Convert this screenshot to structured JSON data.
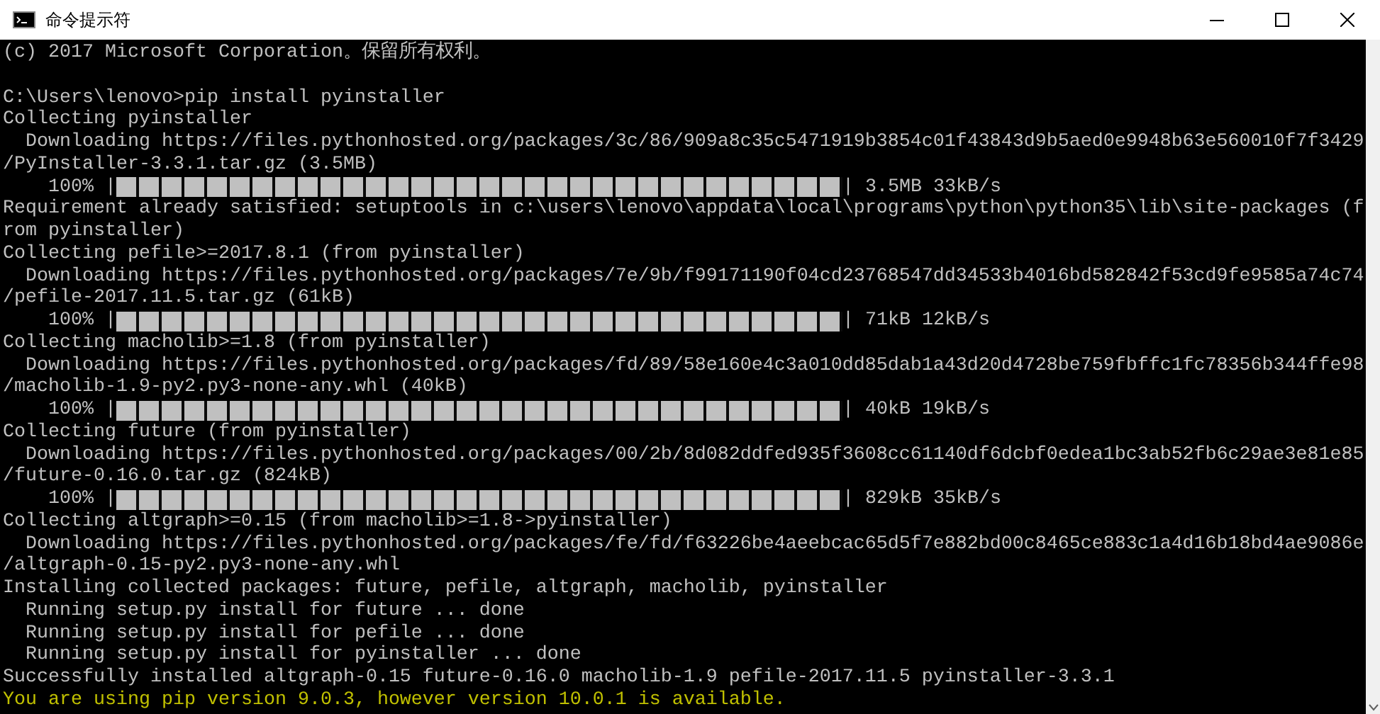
{
  "window": {
    "title": "命令提示符"
  },
  "lines": [
    {
      "kind": "text",
      "text": "(c) 2017 Microsoft Corporation。保留所有权利。"
    },
    {
      "kind": "blank"
    },
    {
      "kind": "text",
      "text": "C:\\Users\\lenovo>pip install pyinstaller"
    },
    {
      "kind": "text",
      "text": "Collecting pyinstaller"
    },
    {
      "kind": "text",
      "text": "  Downloading https://files.pythonhosted.org/packages/3c/86/909a8c35c5471919b3854c01f43843d9b5aed0e9948b63e560010f7f3429"
    },
    {
      "kind": "text",
      "text": "/PyInstaller-3.3.1.tar.gz (3.5MB)"
    },
    {
      "kind": "progress",
      "prefix": "    100% |",
      "level": 1,
      "suffix": "| 3.5MB 33kB/s"
    },
    {
      "kind": "text",
      "text": "Requirement already satisfied: setuptools in c:\\users\\lenovo\\appdata\\local\\programs\\python\\python35\\lib\\site-packages (f"
    },
    {
      "kind": "text",
      "text": "rom pyinstaller)"
    },
    {
      "kind": "text",
      "text": "Collecting pefile>=2017.8.1 (from pyinstaller)"
    },
    {
      "kind": "text",
      "text": "  Downloading https://files.pythonhosted.org/packages/7e/9b/f99171190f04cd23768547dd34533b4016bd582842f53cd9fe9585a74c74"
    },
    {
      "kind": "text",
      "text": "/pefile-2017.11.5.tar.gz (61kB)"
    },
    {
      "kind": "progress",
      "prefix": "    100% |",
      "level": 1,
      "suffix": "| 71kB 12kB/s"
    },
    {
      "kind": "text",
      "text": "Collecting macholib>=1.8 (from pyinstaller)"
    },
    {
      "kind": "text",
      "text": "  Downloading https://files.pythonhosted.org/packages/fd/89/58e160e4c3a010dd85dab1a43d20d4728be759fbffc1fc78356b344ffe98"
    },
    {
      "kind": "text",
      "text": "/macholib-1.9-py2.py3-none-any.whl (40kB)"
    },
    {
      "kind": "progress",
      "prefix": "    100% |",
      "level": 1,
      "suffix": "| 40kB 19kB/s"
    },
    {
      "kind": "text",
      "text": "Collecting future (from pyinstaller)"
    },
    {
      "kind": "text",
      "text": "  Downloading https://files.pythonhosted.org/packages/00/2b/8d082ddfed935f3608cc61140df6dcbf0edea1bc3ab52fb6c29ae3e81e85"
    },
    {
      "kind": "text",
      "text": "/future-0.16.0.tar.gz (824kB)"
    },
    {
      "kind": "progress",
      "prefix": "    100% |",
      "level": 1,
      "suffix": "| 829kB 35kB/s"
    },
    {
      "kind": "text",
      "text": "Collecting altgraph>=0.15 (from macholib>=1.8->pyinstaller)"
    },
    {
      "kind": "text",
      "text": "  Downloading https://files.pythonhosted.org/packages/fe/fd/f63226be4aeebcac65d5f7e882bd00c8465ce883c1a4d16b18bd4ae9086e"
    },
    {
      "kind": "text",
      "text": "/altgraph-0.15-py2.py3-none-any.whl"
    },
    {
      "kind": "text",
      "text": "Installing collected packages: future, pefile, altgraph, macholib, pyinstaller"
    },
    {
      "kind": "text",
      "text": "  Running setup.py install for future ... done"
    },
    {
      "kind": "text",
      "text": "  Running setup.py install for pefile ... done"
    },
    {
      "kind": "text",
      "text": "  Running setup.py install for pyinstaller ... done"
    },
    {
      "kind": "text",
      "text": "Successfully installed altgraph-0.15 future-0.16.0 macholib-1.9 pefile-2017.11.5 pyinstaller-3.3.1"
    },
    {
      "kind": "warning",
      "text": "You are using pip version 9.0.3, however version 10.0.1 is available."
    }
  ]
}
